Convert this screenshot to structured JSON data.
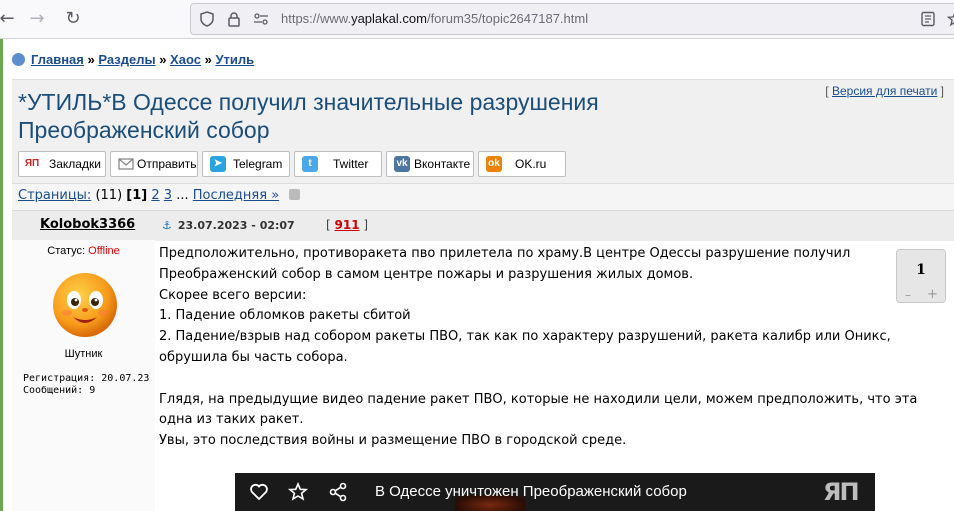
{
  "browser": {
    "url_prefix": "https://www.",
    "url_domain": "yaplakal.com",
    "url_path": "/forum35/topic2647187.html"
  },
  "breadcrumbs": [
    {
      "label": "Главная"
    },
    {
      "label": "Разделы"
    },
    {
      "label": "Хаос"
    },
    {
      "label": "Утиль"
    }
  ],
  "breadcrumb_separator": "»",
  "topic": {
    "title": "*УТИЛЬ*В Одессе получил значительные разрушения Преображенский собор",
    "print_label": "Версия для печати"
  },
  "share": [
    {
      "label": "Закладки",
      "icon": "yap-icon",
      "color": "#c62828"
    },
    {
      "label": "Отправить",
      "icon": "envelope-icon",
      "color": "#888888"
    },
    {
      "label": "Telegram",
      "icon": "telegram-icon",
      "color": "#2aa3e0"
    },
    {
      "label": "Twitter",
      "icon": "twitter-icon",
      "color": "#4aa8e8"
    },
    {
      "label": "Вконтакте",
      "icon": "vk-icon",
      "color": "#4c75a3"
    },
    {
      "label": "OK.ru",
      "icon": "ok-icon",
      "color": "#ee8208"
    }
  ],
  "pagination": {
    "label": "Страницы:",
    "count": "(11)",
    "current": "[1]",
    "pages": [
      "2",
      "3"
    ],
    "ellipsis": "...",
    "last": "Последняя »"
  },
  "post": {
    "author": "Kolobok3366",
    "date": "23.07.2023 - 02:07",
    "reply_number": "911",
    "status_label": "Статус:",
    "status_value": "Offline",
    "rank": "Шутник",
    "registration": "Регистрация: 20.07.23",
    "messages": "Сообщений: 9",
    "rating": "1",
    "rating_minus": "–",
    "rating_plus": "+",
    "body": [
      "Предположительно, противоракета пво прилетела по храму.В центре Одессы разрушение получил Преображенский собор в самом центре пожары и разрушения жилых домов.",
      "Скорее всего версии:",
      "1. Падение обломков ракеты сбитой",
      "2. Падение/взрыв над собором ракеты ПВО, так как по характеру разрушений, ракета калибр или Оникс, обрушила бы часть собора.",
      "",
      "Глядя, на предыдущие видео падение ракет ПВО, которые не находили цели, можем предположить, что эта одна из таких ракет.",
      "Увы, это последствия войны и размещение ПВО в городской среде."
    ]
  },
  "video": {
    "title": "В Одессе уничтожен Преображенский собор",
    "logo": "ЯП"
  }
}
